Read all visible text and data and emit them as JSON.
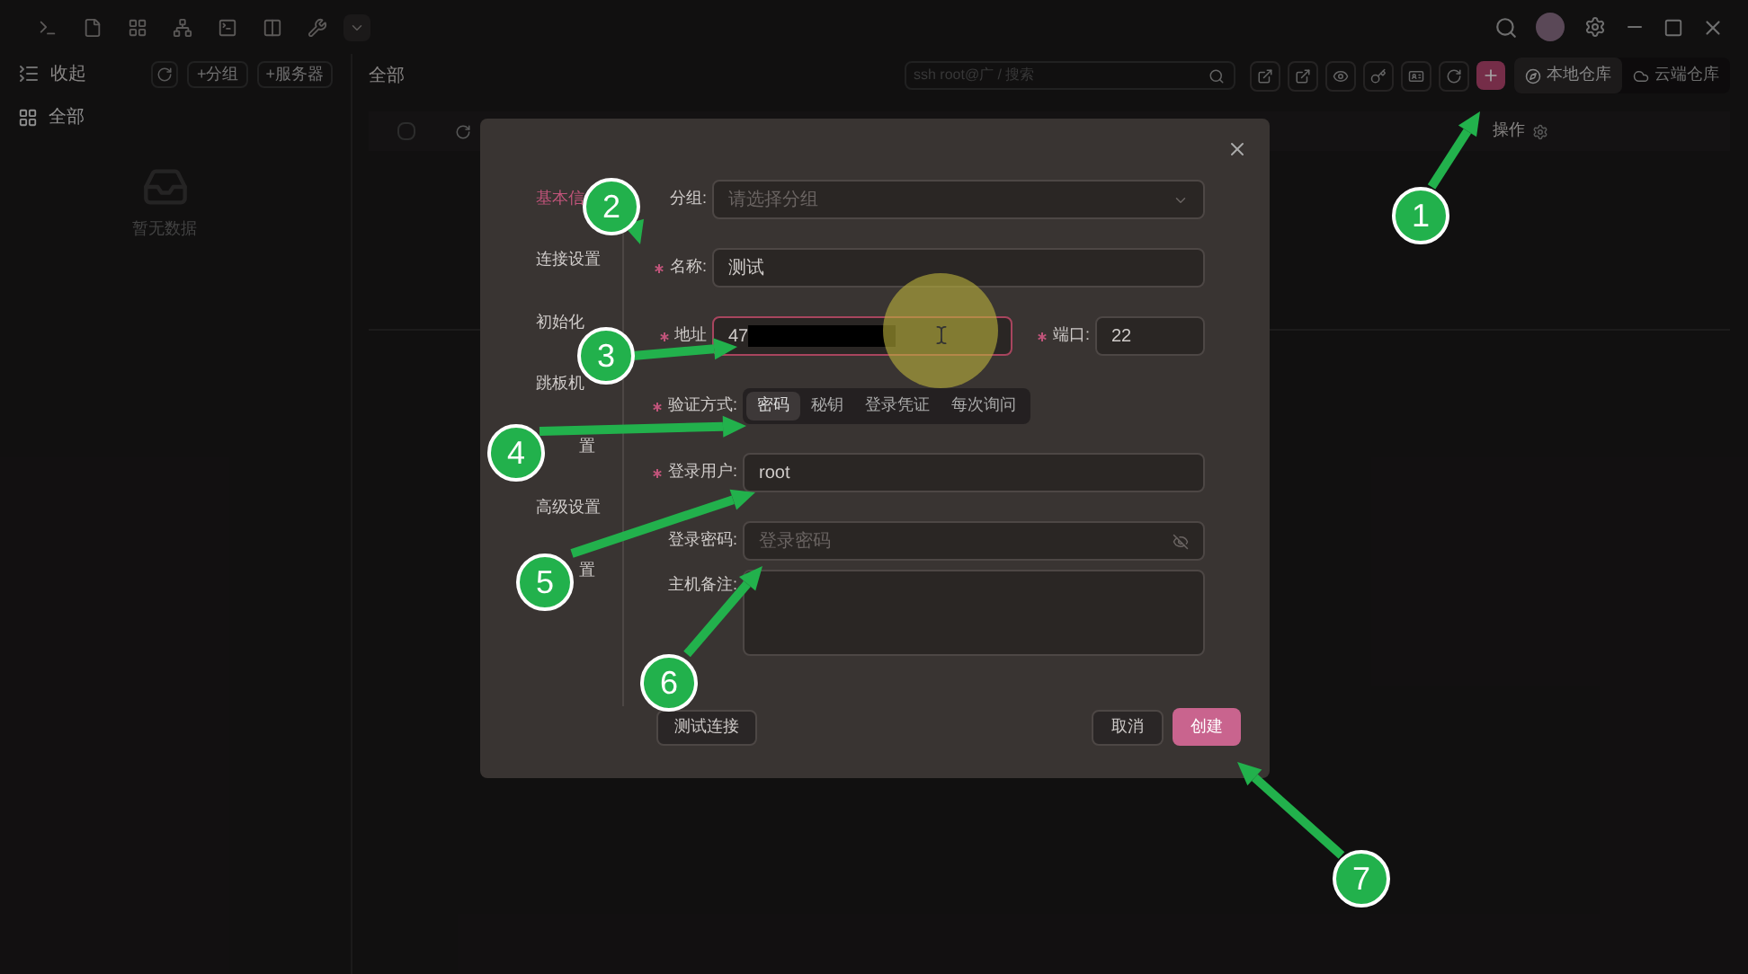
{
  "sidebar": {
    "collapse": "收起",
    "actions": [
      "+分组",
      "+服务器"
    ],
    "items": [
      {
        "label": "全部",
        "selected": true
      }
    ],
    "empty": "暂无数据"
  },
  "main": {
    "title": "全部",
    "search": {
      "placeholder": "ssh root@广 / 搜索"
    },
    "repo_tabs": [
      {
        "label": "本地仓库",
        "selected": true
      },
      {
        "label": "云端仓库",
        "selected": false
      }
    ],
    "table": {
      "select_all": {
        "checked": false
      },
      "columns": [
        "操作"
      ]
    }
  },
  "dialog": {
    "nav": [
      {
        "kind": "plain",
        "label": "基本信",
        "selected": true
      },
      {
        "kind": "plain",
        "label": "连接设置",
        "selected": false
      },
      {
        "kind": "plain",
        "label": "初始化",
        "selected": false
      },
      {
        "kind": "plain",
        "label": "跳板机",
        "selected": false
      },
      {
        "kind": "covered",
        "label": "置",
        "selected": false
      },
      {
        "kind": "plain",
        "label": "高级设置",
        "selected": false
      },
      {
        "kind": "covered",
        "label": "置",
        "selected": false
      }
    ],
    "group": {
      "label": "分组:",
      "placeholder": "请选择分组"
    },
    "name": {
      "label": "名称:",
      "required": true,
      "value": "测试"
    },
    "address": {
      "label": "地址",
      "required": true,
      "value": "47",
      "redacted": true,
      "error": true
    },
    "port": {
      "label": "端口:",
      "required": true,
      "value": "22"
    },
    "auth": {
      "label": "验证方式:",
      "required": true,
      "options": [
        {
          "label": "密码",
          "selected": true
        },
        {
          "label": "秘钥",
          "selected": false
        },
        {
          "label": "登录凭证",
          "selected": false
        },
        {
          "label": "每次询问",
          "selected": false
        }
      ]
    },
    "user": {
      "label": "登录用户:",
      "required": true,
      "value": "root"
    },
    "password": {
      "label": "登录密码:",
      "placeholder": "登录密码"
    },
    "note": {
      "label": "主机备注:"
    },
    "buttons": {
      "test": "测试连接",
      "cancel": "取消",
      "create": "创建"
    }
  },
  "callouts": [
    {
      "label": "1"
    },
    {
      "label": "2"
    },
    {
      "label": "3"
    },
    {
      "label": "4"
    },
    {
      "label": "5"
    },
    {
      "label": "6"
    },
    {
      "label": "7"
    }
  ]
}
